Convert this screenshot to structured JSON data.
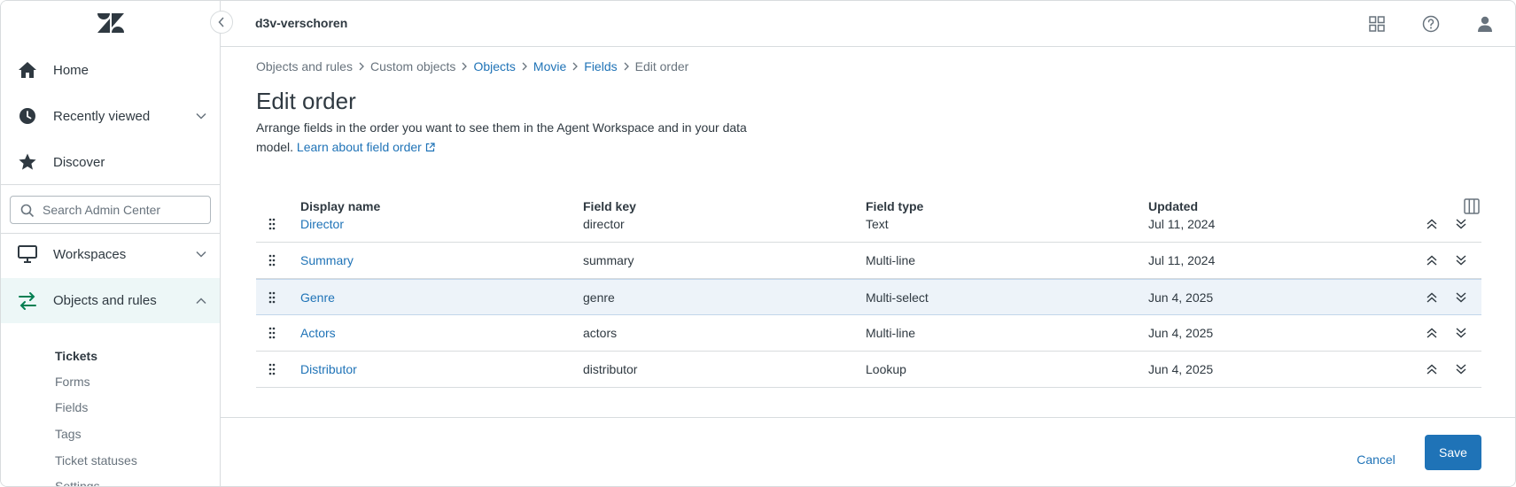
{
  "header": {
    "account_name": "d3v-verschoren",
    "icons": [
      "apps-grid-icon",
      "help-icon",
      "user-icon"
    ]
  },
  "sidebar": {
    "nav": [
      {
        "label": "Home",
        "icon": "home-icon"
      },
      {
        "label": "Recently viewed",
        "icon": "clock-icon",
        "expandable": true
      },
      {
        "label": "Discover",
        "icon": "star-icon"
      },
      {
        "label": "Workspaces",
        "icon": "monitor-icon",
        "expandable": true
      },
      {
        "label": "Objects and rules",
        "icon": "objects-rules-icon",
        "expanded": true,
        "active": true
      }
    ],
    "search_placeholder": "Search Admin Center",
    "section_title": "Tickets",
    "sub_items": [
      "Forms",
      "Fields",
      "Tags",
      "Ticket statuses",
      "Settings"
    ]
  },
  "breadcrumb": [
    {
      "label": "Objects and rules",
      "link": false
    },
    {
      "label": "Custom objects",
      "link": false
    },
    {
      "label": "Objects",
      "link": true
    },
    {
      "label": "Movie",
      "link": true
    },
    {
      "label": "Fields",
      "link": true
    },
    {
      "label": "Edit order",
      "link": false
    }
  ],
  "page": {
    "title": "Edit order",
    "description": "Arrange fields in the order you want to see them in the Agent Workspace and in your data model.",
    "learn_link": "Learn about field order"
  },
  "table": {
    "columns": [
      "Display name",
      "Field key",
      "Field type",
      "Updated"
    ],
    "rows": [
      {
        "name": "Director",
        "key": "director",
        "type": "Text",
        "updated": "Jul 11, 2024"
      },
      {
        "name": "Summary",
        "key": "summary",
        "type": "Multi-line",
        "updated": "Jul 11, 2024"
      },
      {
        "name": "Genre",
        "key": "genre",
        "type": "Multi-select",
        "updated": "Jun 4, 2025",
        "highlighted": true
      },
      {
        "name": "Actors",
        "key": "actors",
        "type": "Multi-line",
        "updated": "Jun 4, 2025"
      },
      {
        "name": "Distributor",
        "key": "distributor",
        "type": "Lookup",
        "updated": "Jun 4, 2025"
      }
    ]
  },
  "footer": {
    "cancel_label": "Cancel",
    "save_label": "Save"
  },
  "colors": {
    "accent": "#1f73b7",
    "active_nav_bg": "#edf7f7",
    "highlight_row_bg": "#edf3f9",
    "text": "#2f3941",
    "muted": "#68737d"
  }
}
